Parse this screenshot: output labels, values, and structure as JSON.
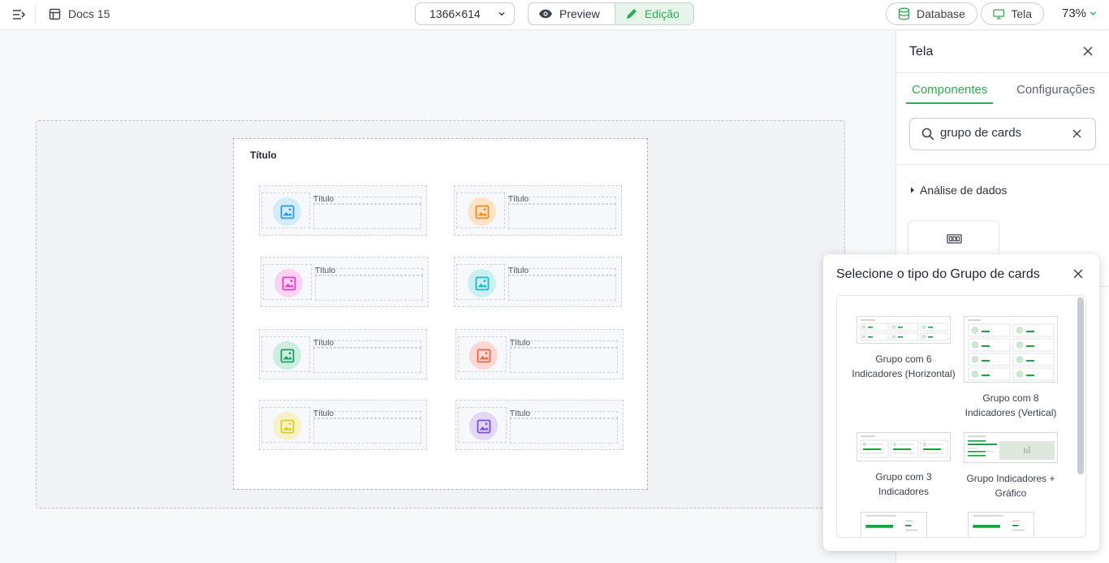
{
  "topbar": {
    "doc_name": "Docs 15",
    "resolution": "1366×614",
    "preview_label": "Preview",
    "edit_label": "Edição",
    "database_label": "Database",
    "tela_label": "Tela",
    "zoom": "73%"
  },
  "page": {
    "title": "Título",
    "cards": [
      {
        "label": "Título",
        "color": "#2f9be0",
        "bg": "#d4ebfa"
      },
      {
        "label": "Título",
        "color": "#f08c24",
        "bg": "#fde4c9"
      },
      {
        "label": "Título",
        "color": "#e13fc4",
        "bg": "#f9d3f1"
      },
      {
        "label": "Título",
        "color": "#1eb8c4",
        "bg": "#caf0f3"
      },
      {
        "label": "Título",
        "color": "#1f9e6a",
        "bg": "#cdeee0"
      },
      {
        "label": "Título",
        "color": "#e8664f",
        "bg": "#fbd8d1"
      },
      {
        "label": "Título",
        "color": "#d8cc2e",
        "bg": "#f7f2c4"
      },
      {
        "label": "Título",
        "color": "#7b4fd6",
        "bg": "#e2d7f7"
      }
    ]
  },
  "panel": {
    "title": "Tela",
    "tabs": [
      "Componentes",
      "Configurações"
    ],
    "search_value": "grupo de cards",
    "section": "Análise de dados"
  },
  "popup": {
    "title": "Selecione o tipo do Grupo de cards",
    "options": [
      {
        "label": "Grupo com 6 Indicadores (Horizontal)"
      },
      {
        "label": "Grupo com 8 Indicadores (Vertical)"
      },
      {
        "label": "Grupo com 3 Indicadores"
      },
      {
        "label": "Grupo Indicadores + Gráfico"
      }
    ]
  },
  "colors": {
    "accent": "#34a853",
    "accent_bg": "#e6f5e9"
  }
}
